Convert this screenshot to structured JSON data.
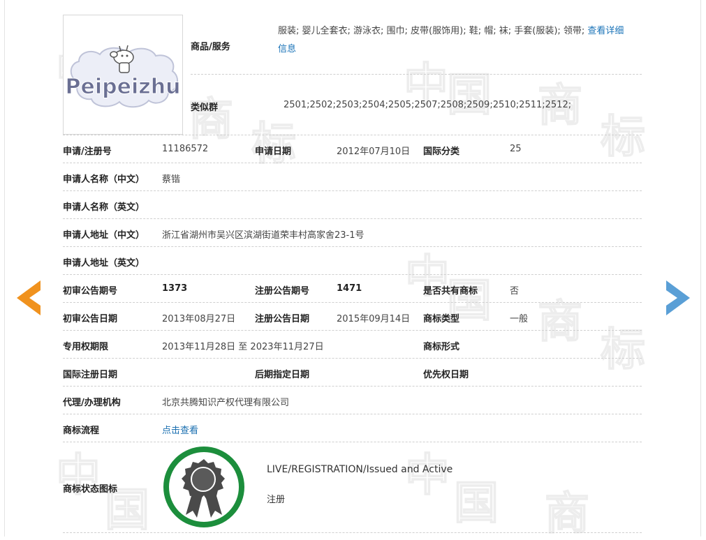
{
  "goods": {
    "label": "商品/服务",
    "text": "服装; 婴儿全套衣; 游泳衣; 围巾; 皮带(服饰用); 鞋; 帽; 袜; 手套(服装); 领带;",
    "detail_link_part1": "查看详细",
    "detail_link_part2": "信息"
  },
  "similar_group": {
    "label": "类似群",
    "value": "2501;2502;2503;2504;2505;2507;2508;2509;2510;2511;2512;"
  },
  "logo": {
    "text": "Peipeizhu"
  },
  "watermark": {
    "chars": [
      "中",
      "国",
      "商",
      "标"
    ]
  },
  "rows": {
    "reg_no_label": "申请/注册号",
    "reg_no": "11186572",
    "apply_date_label": "申请日期",
    "apply_date": "2012年07月10日",
    "intl_class_label": "国际分类",
    "intl_class": "25",
    "applicant_cn_label": "申请人名称（中文）",
    "applicant_cn": "蔡锴",
    "applicant_en_label": "申请人名称（英文）",
    "address_cn_label": "申请人地址（中文）",
    "address_cn": "浙江省湖州市吴兴区滨湖街道荣丰村高家舍23-1号",
    "address_en_label": "申请人地址（英文）",
    "prelim_issue_no_label": "初审公告期号",
    "prelim_issue_no": "1373",
    "reg_issue_no_label": "注册公告期号",
    "reg_issue_no": "1471",
    "shared_label": "是否共有商标",
    "shared": "否",
    "prelim_date_label": "初审公告日期",
    "prelim_date": "2013年08月27日",
    "reg_issue_date_label": "注册公告日期",
    "reg_issue_date": "2015年09月14日",
    "tm_type_label": "商标类型",
    "tm_type": "一般",
    "exclusive_label": "专用权期限",
    "exclusive": "2013年11月28日 至 2023年11月27日",
    "tm_form_label": "商标形式",
    "intl_reg_date_label": "国际注册日期",
    "later_date_label": "后期指定日期",
    "priority_date_label": "优先权日期",
    "agent_label": "代理/办理机构",
    "agent": "北京共腾知识产权代理有限公司",
    "process_label": "商标流程",
    "process_link": "点击查看",
    "status_icon_label": "商标状态图标"
  },
  "status": {
    "en": "LIVE/REGISTRATION/Issued and Active",
    "cn": "注册"
  },
  "colors": {
    "link": "#1a6fb0",
    "prev_arrow": "#f0921e",
    "next_arrow": "#5a9fd6",
    "badge_ring": "#1c8e3c",
    "badge_seal": "#4a4a4a"
  }
}
